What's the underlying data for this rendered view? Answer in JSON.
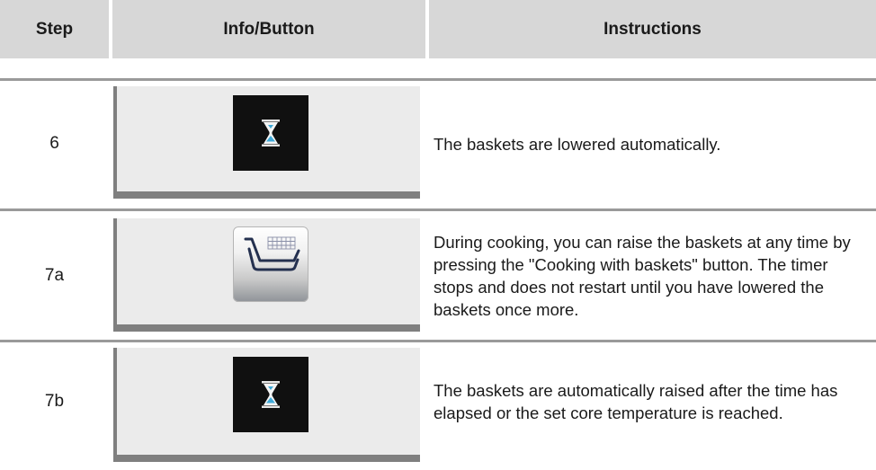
{
  "header": {
    "step": "Step",
    "info_button": "Info/Button",
    "instructions": "Instructions"
  },
  "rows": [
    {
      "step": "6",
      "icon": "hourglass-icon",
      "instructions": "The baskets are lowered automatically."
    },
    {
      "step": "7a",
      "icon": "cooking-with-baskets-icon",
      "instructions": "During cooking, you can raise the baskets at any time by pressing the \"Cooking with baskets\" button. The timer stops and does not restart until you have lowered the baskets once more."
    },
    {
      "step": "7b",
      "icon": "hourglass-icon",
      "instructions": "The baskets are automatically raised after the time has elapsed or the set core temperature is reached."
    }
  ],
  "colors": {
    "header_bg": "#d7d7d7",
    "panel_bg": "#ebebeb",
    "panel_border": "#7f7f7f",
    "hourglass_sand": "#3fa9d8"
  }
}
